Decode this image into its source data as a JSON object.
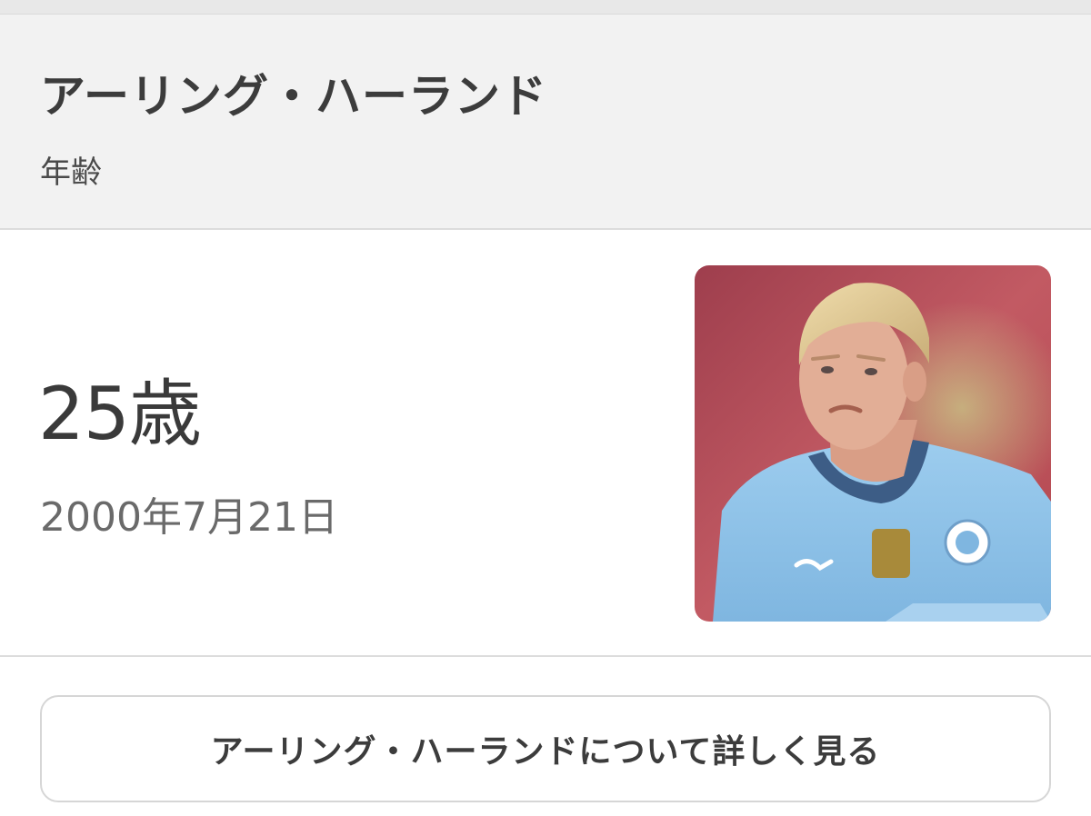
{
  "header": {
    "title": "アーリング・ハーランド",
    "subtitle": "年齢"
  },
  "main": {
    "age": "25歳",
    "birthdate": "2000年7月21日",
    "photo": {
      "subject": "player-photo",
      "colors": {
        "kit": "#8fc3ea",
        "hair": "#e4cf9c",
        "skin": "#e2ae96",
        "background": "#b54a58"
      }
    }
  },
  "more_button": {
    "label": "アーリング・ハーランドについて詳しく見る"
  }
}
